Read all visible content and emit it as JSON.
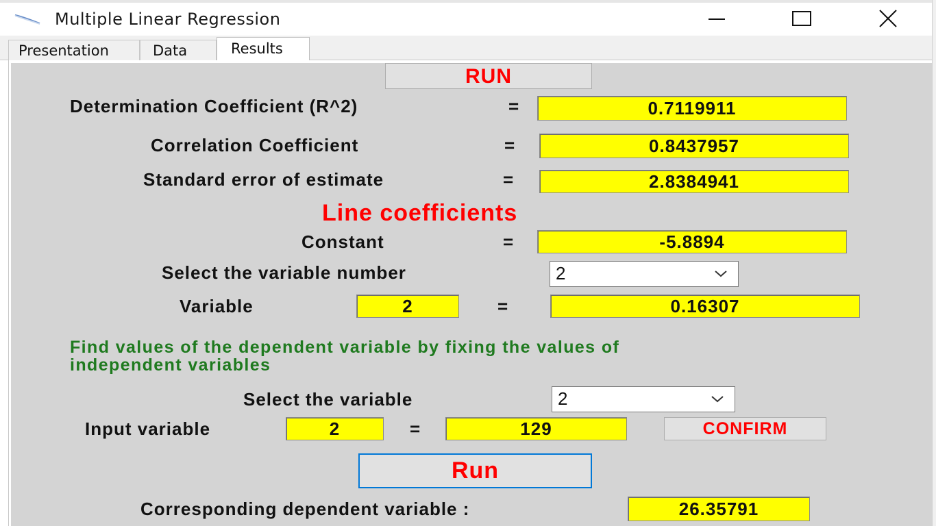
{
  "window": {
    "title": "Multiple Linear Regression",
    "icon": "regression-app-icon",
    "controls": [
      "minimize-icon",
      "maximize-icon",
      "close-icon"
    ]
  },
  "tabs": [
    {
      "label": "Presentation",
      "active": false
    },
    {
      "label": "Data",
      "active": false
    },
    {
      "label": "Results",
      "active": true
    }
  ],
  "results": {
    "run_top_label": "RUN",
    "equals": "=",
    "r2_label": "Determination Coefficient  (R^2)",
    "r2_value": "0.7119911",
    "corr_label": "Correlation Coefficient",
    "corr_value": "0.8437957",
    "stderr_label": "Standard error of estimate",
    "stderr_value": "2.8384941",
    "line_coeff_heading": "Line coefficients",
    "constant_label": "Constant",
    "constant_value": "-5.8894",
    "select_var_number_label": "Select the variable number",
    "select_var_number_value": "2",
    "variable_label": "Variable",
    "variable_index": "2",
    "variable_coeff": "0.16307",
    "find_values_text_line1": "Find values of the dependent variable by fixing the values of",
    "find_values_text_line2": "independent variables",
    "select_variable_label": "Select the variable",
    "select_variable_value": "2",
    "input_variable_label": "Input variable",
    "input_variable_index": "2",
    "input_variable_value": "129",
    "confirm_label": "CONFIRM",
    "run_bottom_label": "Run",
    "dependent_label": "Corresponding dependent variable :",
    "dependent_value": "26.35791"
  },
  "colors": {
    "field_bg": "#ffff00",
    "accent_red": "#ff0000",
    "text_green": "#1f7a1f",
    "panel_bg": "#d4d4d4"
  }
}
